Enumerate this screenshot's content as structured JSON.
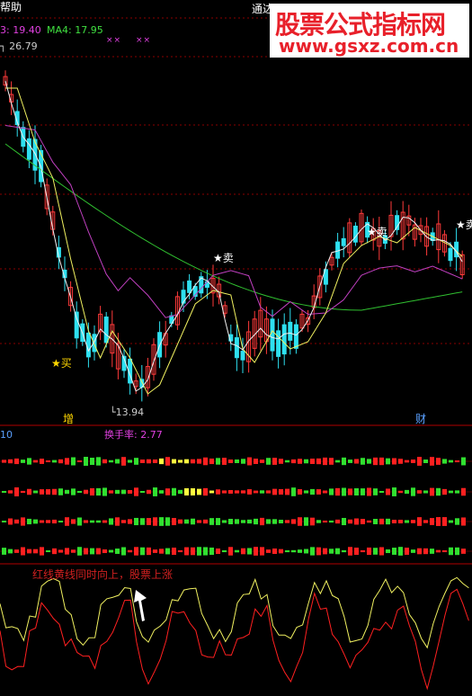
{
  "window": {
    "title_left": "帮助",
    "title_right": "通达"
  },
  "watermark": {
    "line1": "股票公式指标网",
    "line2": "www.gsxz.com.cn"
  },
  "main_panel": {
    "ma_text_a": "3: 19.40",
    "ma_text_b": "MA4: 17.95",
    "crosses": "×× ××",
    "price_top_label": "26.79",
    "price_low_label": "13.94",
    "signals": {
      "buy": "买",
      "sell": "卖",
      "star": "★"
    },
    "bottom_left_tag": "增",
    "bottom_right_tag": "财"
  },
  "turnover_panel": {
    "left_tag": "10",
    "title": "换手率: 2.77"
  },
  "osc_panel": {
    "annotation": "红线黄线同时向上，股票上涨"
  },
  "colors": {
    "up": "#ff3a3a",
    "down": "#2ee0f0",
    "ma_white": "#f0f0f0",
    "ma_yellow": "#f0f060",
    "ma_magenta": "#c040c0",
    "ma_green": "#30c030",
    "grid": "#8a0000",
    "panel_line": "#b00000",
    "bar_green": "#30e030",
    "bar_red": "#ff2020",
    "bar_yellow": "#ffff40"
  },
  "chart_data": {
    "type": "candlestick",
    "price_marks": {
      "high": 26.79,
      "low": 13.94
    },
    "ma_readout": {
      "ma3": 19.4,
      "ma4": 17.95
    },
    "turnover": 2.77
  }
}
